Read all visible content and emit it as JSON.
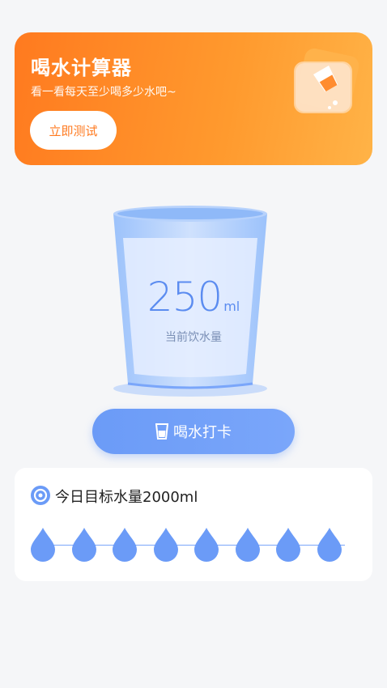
{
  "banner": {
    "title": "喝水计算器",
    "subtitle": "看一看每天至少喝多少水吧~",
    "button_label": "立即测试",
    "colors": {
      "start": "#ff7a1f",
      "end": "#ffb347"
    }
  },
  "cup": {
    "amount": "250",
    "unit": "ml",
    "label": "当前饮水量"
  },
  "checkin": {
    "label": "喝水打卡",
    "icon": "cup-icon"
  },
  "goal": {
    "text": "今日目标水量2000ml",
    "icon": "target-icon",
    "drops": 8,
    "drop_color": "#6b9bf7"
  }
}
